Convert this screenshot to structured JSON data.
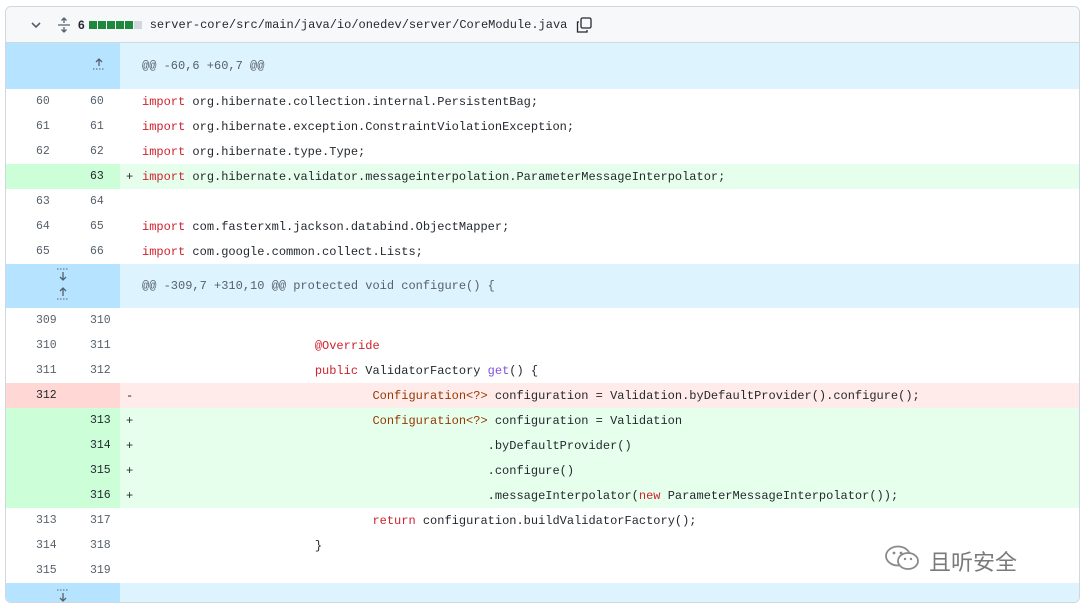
{
  "file": {
    "changed_count": "6",
    "path": "server-core/src/main/java/io/onedev/server/CoreModule.java",
    "diffstat_colors": [
      "#1f883d",
      "#1f883d",
      "#1f883d",
      "#1f883d",
      "#1f883d",
      "#d0d7de"
    ]
  },
  "hunks": [
    {
      "header": "@@ -60,6 +60,7 @@"
    },
    {
      "header": "@@ -309,7 +310,10 @@ protected void configure() {"
    }
  ],
  "lines": [
    {
      "old": "60",
      "new": "60",
      "sign": " ",
      "kw": "import",
      "rest": " org.hibernate.collection.internal.PersistentBag;"
    },
    {
      "old": "61",
      "new": "61",
      "sign": " ",
      "kw": "import",
      "rest": " org.hibernate.exception.ConstraintViolationException;"
    },
    {
      "old": "62",
      "new": "62",
      "sign": " ",
      "kw": "import",
      "rest": " org.hibernate.type.Type;"
    },
    {
      "old": "",
      "new": "63",
      "sign": "+",
      "kw": "import",
      "rest": " org.hibernate.validator.messageinterpolation.ParameterMessageInterpolator;"
    },
    {
      "old": "63",
      "new": "64",
      "sign": " ",
      "kw": "",
      "rest": ""
    },
    {
      "old": "64",
      "new": "65",
      "sign": " ",
      "kw": "import",
      "rest": " com.fasterxml.jackson.databind.ObjectMapper;"
    },
    {
      "old": "65",
      "new": "66",
      "sign": " ",
      "kw": "import",
      "rest": " com.google.common.collect.Lists;"
    },
    {
      "old": "309",
      "new": "310",
      "sign": " ",
      "indent": "",
      "text": ""
    },
    {
      "old": "310",
      "new": "311",
      "sign": " ",
      "indent": "                        ",
      "ann": "@Override"
    },
    {
      "old": "311",
      "new": "312",
      "sign": " ",
      "indent": "                        ",
      "kw": "public",
      "mid": " ValidatorFactory ",
      "fn": "get",
      "tail": "() {"
    },
    {
      "old": "312",
      "new": "",
      "sign": "-",
      "indent": "                                ",
      "type": "Configuration<?>",
      "rest": " configuration = Validation.byDefaultProvider().configure();"
    },
    {
      "old": "",
      "new": "313",
      "sign": "+",
      "indent": "                                ",
      "type": "Configuration<?>",
      "rest": " configuration = Validation"
    },
    {
      "old": "",
      "new": "314",
      "sign": "+",
      "indent": "                                                ",
      "rest": ".byDefaultProvider()"
    },
    {
      "old": "",
      "new": "315",
      "sign": "+",
      "indent": "                                                ",
      "rest": ".configure()"
    },
    {
      "old": "",
      "new": "316",
      "sign": "+",
      "indent": "                                                ",
      "pre": ".messageInterpolator(",
      "kw": "new",
      "rest": " ParameterMessageInterpolator());"
    },
    {
      "old": "313",
      "new": "317",
      "sign": " ",
      "indent": "                                ",
      "kw": "return",
      "rest": " configuration.buildValidatorFactory();"
    },
    {
      "old": "314",
      "new": "318",
      "sign": " ",
      "indent": "                        ",
      "rest": "}"
    },
    {
      "old": "315",
      "new": "319",
      "sign": " ",
      "indent": "",
      "rest": ""
    }
  ],
  "watermark": "且听安全"
}
